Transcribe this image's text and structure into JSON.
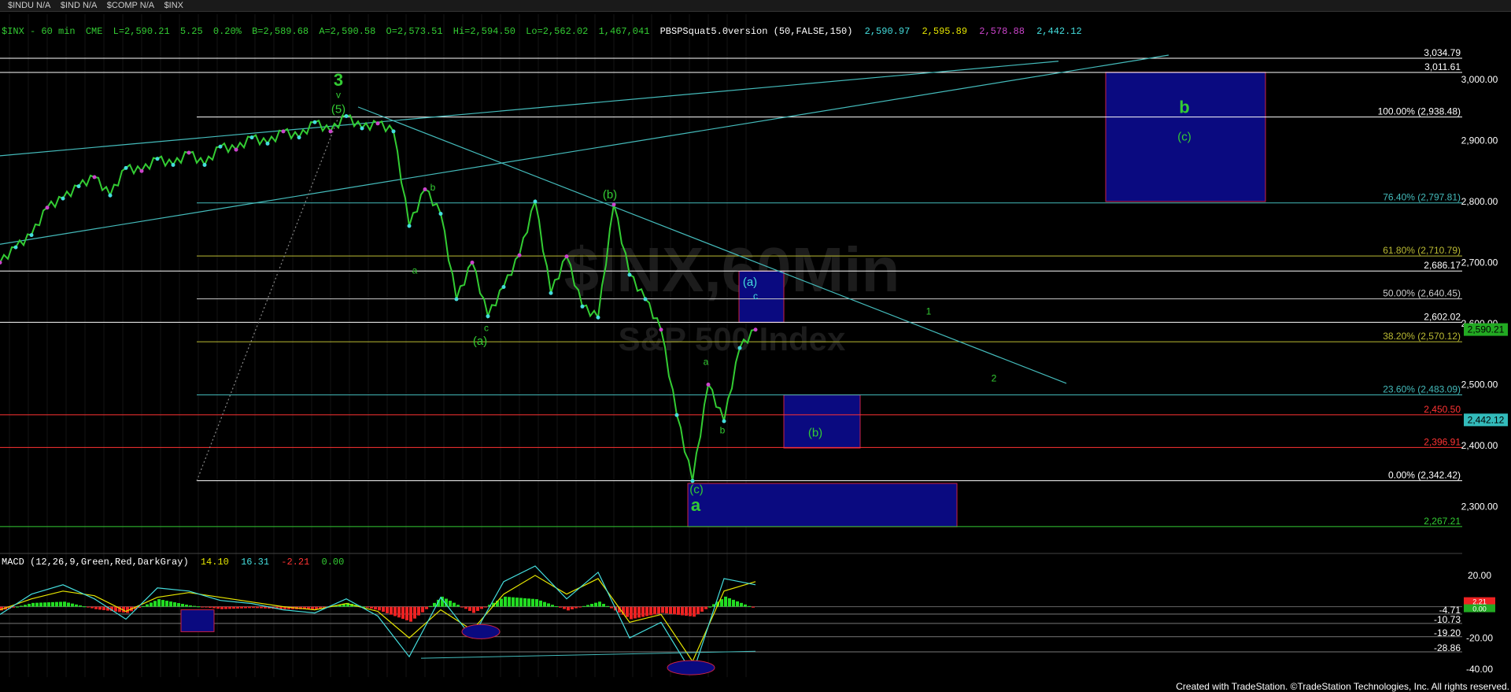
{
  "ticker_bar": [
    "$INDU N/A",
    "$IND N/A",
    "$COMP N/A",
    "$INX"
  ],
  "header": {
    "symbol": "$INX - 60 min",
    "exchange": "CME",
    "last": "L=2,590.21",
    "change": "5.25",
    "change_pct": "0.20%",
    "bid": "B=2,589.68",
    "ask": "A=2,590.58",
    "open": "O=2,573.51",
    "high": "Hi=2,594.50",
    "low": "Lo=2,562.02",
    "volume": "1,467,041",
    "study": "PBSPSquat5.0version (50,FALSE,150)",
    "study_values": [
      "2,590.97",
      "2,595.89",
      "2,578.88",
      "2,442.12"
    ]
  },
  "colors": {
    "green": "#33cc33",
    "cyan": "#44dddd",
    "yellow": "#e6e600",
    "magenta": "#cc44cc",
    "red": "#ff3333",
    "white": "#ffffff",
    "box": "#0a0a80"
  },
  "watermark": [
    "$INX,60Min",
    "S&P 500 Index"
  ],
  "footer": "Created with TradeStation. ©TradeStation Technologies, Inc. All rights reserved.",
  "chart_data": [
    {
      "type": "line",
      "name": "price",
      "ylim": [
        2240,
        3040
      ],
      "y_ticks": [
        2300,
        2400,
        2500,
        2600,
        2700,
        2800,
        2900,
        3000
      ],
      "y_tick_labels": [
        "2,300.00",
        "2,400.00",
        "2,500.00",
        "2,600.00",
        "2,700.00",
        "2,800.00",
        "2,900.00",
        "3,000.00"
      ],
      "last_price_tags": [
        "2,590.21",
        "2,442.12"
      ],
      "x": [
        0,
        20,
        40,
        60,
        80,
        100,
        120,
        140,
        160,
        180,
        200,
        220,
        240,
        260,
        280,
        300,
        320,
        340,
        360,
        380,
        400,
        420,
        440,
        460,
        480,
        500,
        520,
        540,
        560,
        580,
        600,
        620,
        640,
        660,
        680,
        700,
        720,
        740,
        760,
        780,
        800,
        820,
        840,
        860,
        880,
        900,
        920,
        940,
        960
      ],
      "y": [
        2700,
        2725,
        2745,
        2790,
        2805,
        2825,
        2840,
        2810,
        2855,
        2850,
        2870,
        2860,
        2880,
        2860,
        2890,
        2885,
        2905,
        2895,
        2915,
        2905,
        2930,
        2915,
        2940,
        2920,
        2928,
        2915,
        2760,
        2820,
        2780,
        2640,
        2700,
        2612,
        2660,
        2712,
        2800,
        2650,
        2710,
        2628,
        2610,
        2795,
        2680,
        2640,
        2590,
        2450,
        2342,
        2500,
        2440,
        2560,
        2590
      ],
      "levels": [
        {
          "label": "3,034.79",
          "value": 3034.79,
          "color": "#ffffff"
        },
        {
          "label": "3,011.61",
          "value": 3011.61,
          "color": "#ffffff"
        },
        {
          "label": "100.00% (2,938.48)",
          "value": 2938.48,
          "color": "#ffffff"
        },
        {
          "label": "76.40% (2,797.81)",
          "value": 2797.81,
          "color": "#44bbbb"
        },
        {
          "label": "61.80% (2,710.79)",
          "value": 2710.79,
          "color": "#bbbb33"
        },
        {
          "label": "2,686.17",
          "value": 2686.17,
          "color": "#ffffff"
        },
        {
          "label": "50.00% (2,640.45)",
          "value": 2640.45,
          "color": "#cccccc"
        },
        {
          "label": "2,602.02",
          "value": 2602.02,
          "color": "#ffffff"
        },
        {
          "label": "38.20% (2,570.12)",
          "value": 2570.12,
          "color": "#bbbb33"
        },
        {
          "label": "23.60% (2,483.09)",
          "value": 2483.09,
          "color": "#44bbbb"
        },
        {
          "label": "2,450.50",
          "value": 2450.5,
          "color": "#ff3333"
        },
        {
          "label": "2,396.91",
          "value": 2396.91,
          "color": "#ff3333"
        },
        {
          "label": "0.00% (2,342.42)",
          "value": 2342.42,
          "color": "#ffffff"
        },
        {
          "label": "2,267.21",
          "value": 2267.21,
          "color": "#33cc33"
        }
      ],
      "boxes": [
        {
          "x0": 1405,
          "x1": 1608,
          "y0": 2800,
          "y1": 3012
        },
        {
          "x0": 939,
          "x1": 996,
          "y0": 2602,
          "y1": 2686
        },
        {
          "x0": 996,
          "x1": 1093,
          "y0": 2396,
          "y1": 2483
        },
        {
          "x0": 874,
          "x1": 1216,
          "y0": 2267,
          "y1": 2338
        }
      ],
      "wave_labels": [
        {
          "text": "3",
          "x": 430,
          "y": 2990,
          "color": "#33cc33"
        },
        {
          "text": "v",
          "x": 430,
          "y": 2970,
          "color": "#33cc33"
        },
        {
          "text": "(5)",
          "x": 430,
          "y": 2945,
          "color": "#33cc33"
        },
        {
          "text": "b",
          "x": 550,
          "y": 2818,
          "color": "#33cc33"
        },
        {
          "text": "a",
          "x": 527,
          "y": 2682,
          "color": "#33cc33"
        },
        {
          "text": "c",
          "x": 618,
          "y": 2588,
          "color": "#33cc33"
        },
        {
          "text": "(a)",
          "x": 610,
          "y": 2565,
          "color": "#33cc33"
        },
        {
          "text": "(b)",
          "x": 775,
          "y": 2805,
          "color": "#33cc33"
        },
        {
          "text": "(a)",
          "x": 953,
          "y": 2662,
          "color": "#44dddd"
        },
        {
          "text": "c",
          "x": 960,
          "y": 2640,
          "color": "#44dddd"
        },
        {
          "text": "1",
          "x": 1180,
          "y": 2615,
          "color": "#33cc33"
        },
        {
          "text": "2",
          "x": 1263,
          "y": 2505,
          "color": "#33cc33"
        },
        {
          "text": "a",
          "x": 897,
          "y": 2532,
          "color": "#33cc33"
        },
        {
          "text": "b",
          "x": 918,
          "y": 2420,
          "color": "#33cc33"
        },
        {
          "text": "(b)",
          "x": 1036,
          "y": 2415,
          "color": "#33cc33"
        },
        {
          "text": "(c)",
          "x": 885,
          "y": 2322,
          "color": "#33cc33"
        },
        {
          "text": "a",
          "x": 884,
          "y": 2293,
          "color": "#33cc33"
        },
        {
          "text": "b",
          "x": 1505,
          "y": 2945,
          "color": "#33cc33"
        },
        {
          "text": "(c)",
          "x": 1505,
          "y": 2900,
          "color": "#33cc33"
        }
      ],
      "trendlines": [
        {
          "x1": 0,
          "y1": 2730,
          "x2": 1485,
          "y2": 3040,
          "color": "#44bbbb"
        },
        {
          "x1": 0,
          "y1": 2875,
          "x2": 1345,
          "y2": 3030,
          "color": "#44bbbb"
        },
        {
          "x1": 455,
          "y1": 2955,
          "x2": 1355,
          "y2": 2502,
          "color": "#44bbbb"
        },
        {
          "x1": 250,
          "y1": 2342,
          "x2": 430,
          "y2": 2938,
          "color": "#888888",
          "dashed": true
        }
      ]
    },
    {
      "type": "line",
      "name": "MACD (12,26,9,Green,Red,DarkGray)",
      "legend_values": [
        "14.10",
        "16.31",
        "-2.21",
        "0.00"
      ],
      "ylim": [
        -45,
        28
      ],
      "y_ticks": [
        20,
        -20,
        -40
      ],
      "y_tick_labels": [
        "20.00",
        "-20.00",
        "-40.00"
      ],
      "level_labels": [
        {
          "label": "-4.71",
          "value": -4.71
        },
        {
          "label": "-10.73",
          "value": -10.73
        },
        {
          "label": "-19.20",
          "value": -19.2
        },
        {
          "label": "-28.86",
          "value": -28.86
        }
      ],
      "right_tags": [
        "2.21",
        "0.00"
      ],
      "x": [
        0,
        40,
        80,
        120,
        160,
        200,
        240,
        280,
        320,
        360,
        400,
        440,
        480,
        520,
        560,
        600,
        640,
        680,
        720,
        760,
        800,
        840,
        880,
        920,
        960
      ],
      "macd": [
        -5,
        8,
        14,
        5,
        -8,
        12,
        10,
        4,
        2,
        -2,
        -4,
        5,
        -6,
        -32,
        6,
        -20,
        16,
        26,
        5,
        22,
        -20,
        -10,
        -43,
        18,
        14
      ],
      "signal": [
        -2,
        5,
        10,
        7,
        -3,
        6,
        9,
        6,
        3,
        0,
        -2,
        2,
        -3,
        -20,
        -2,
        -15,
        8,
        20,
        8,
        18,
        -10,
        -5,
        -35,
        10,
        16
      ]
    }
  ]
}
